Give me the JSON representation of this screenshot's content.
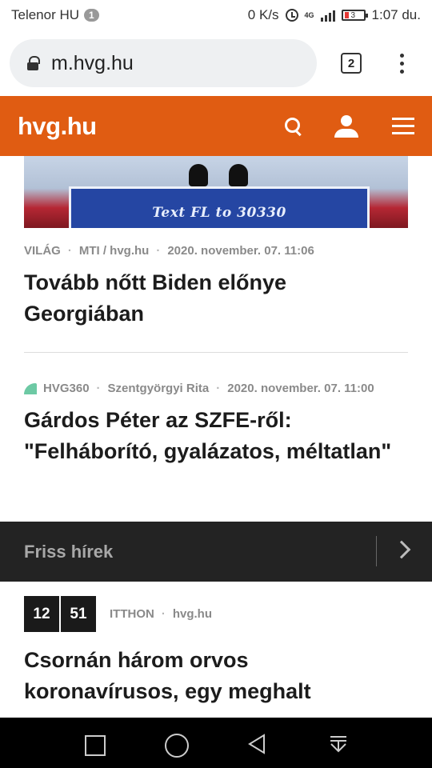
{
  "status_bar": {
    "carrier": "Telenor HU",
    "notification_count": "1",
    "speed": "0 K/s",
    "network": "4G",
    "battery": "3",
    "time": "1:07 du."
  },
  "browser": {
    "url": "m.hvg.hu",
    "tab_count": "2"
  },
  "site": {
    "logo": "hvg.hu",
    "brand_color": "#e05c12",
    "icons": [
      "search-icon",
      "user-icon",
      "hamburger-icon"
    ]
  },
  "hero_image": {
    "sign_text": "Text FL to 30330"
  },
  "articles": [
    {
      "category": "VILÁG",
      "source": "MTI / hvg.hu",
      "date": "2020. november. 07. 11:06",
      "headline": "Tovább nőtt Biden előnye Georgiában"
    },
    {
      "category": "HVG360",
      "author": "Szentgyörgyi Rita",
      "date": "2020. november. 07. 11:00",
      "headline": "Gárdos Péter az SZFE-ről: \"Felháborító, gyalázatos, méltatlan\""
    }
  ],
  "fresh_news": {
    "title": "Friss hírek",
    "items": [
      {
        "hour": "12",
        "minute": "51",
        "category": "ITTHON",
        "source": "hvg.hu",
        "headline": "Csornán három orvos koronavírusos, egy meghalt"
      }
    ]
  }
}
